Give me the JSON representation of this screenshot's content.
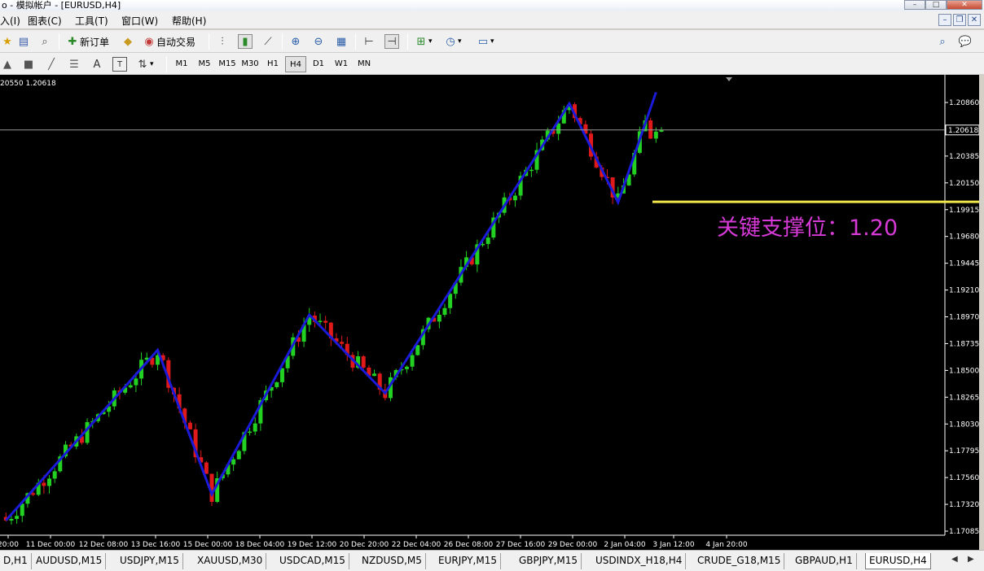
{
  "window": {
    "title": "o - 模拟帐户 - [EURUSD,H4]",
    "min": "–",
    "max": "□",
    "close": "✕"
  },
  "menu": [
    "入(I)",
    "图表(C)",
    "工具(T)",
    "窗口(W)",
    "帮助(H)"
  ],
  "toolbar": {
    "new_order": "新订单",
    "auto_trade": "自动交易"
  },
  "timeframes": [
    "M1",
    "M5",
    "M15",
    "M30",
    "H1",
    "H4",
    "D1",
    "W1",
    "MN"
  ],
  "active_timeframe": "H4",
  "chart": {
    "info_text": "20550 1.20618",
    "annotation": "关键支撑位：1.20",
    "price_labels": [
      "1.20860",
      "1.20618",
      "1.20385",
      "1.20150",
      "1.19915",
      "1.19680",
      "1.19445",
      "1.19210",
      "1.18970",
      "1.18735",
      "1.18500",
      "1.18265",
      "1.18030",
      "1.17795",
      "1.17560",
      "1.17320",
      "1.17085"
    ],
    "current_price": "1.20618",
    "time_labels": [
      "20:00",
      "11 Dec 00:00",
      "12 Dec 08:00",
      "13 Dec 16:00",
      "15 Dec 00:00",
      "18 Dec 04:00",
      "19 Dec 12:00",
      "20 Dec 20:00",
      "22 Dec 04:00",
      "26 Dec 08:00",
      "27 Dec 16:00",
      "29 Dec 00:00",
      "2 Jan 04:00",
      "3 Jan 12:00",
      "4 Jan 20:00"
    ],
    "colors": {
      "background": "#000000",
      "bull": "#22d122",
      "bear": "#e01a1a",
      "zigzag": "#1a1ad8",
      "support": "#f0e64a",
      "annotation": "#d63ad6",
      "axis_text": "#ffffff"
    }
  },
  "chart_data": {
    "type": "candlestick",
    "symbol": "EURUSD",
    "timeframe": "H4",
    "ylim": [
      1.17085,
      1.2086
    ],
    "support_level": 1.19985,
    "zigzag": [
      {
        "bar": 0,
        "price": 1.1718
      },
      {
        "bar": 28,
        "price": 1.1868
      },
      {
        "bar": 38,
        "price": 1.1741
      },
      {
        "bar": 56,
        "price": 1.1899
      },
      {
        "bar": 70,
        "price": 1.183
      },
      {
        "bar": 104,
        "price": 1.2085
      },
      {
        "bar": 113,
        "price": 1.1998
      },
      {
        "bar": 120,
        "price": 1.2095
      }
    ],
    "final_close": 1.20618
  },
  "tabs": [
    "D,H1",
    "AUDUSD,M15",
    "USDJPY,M15",
    "XAUUSD,M30",
    "USDCAD,M15",
    "NZDUSD,M5",
    "EURJPY,M15",
    "GBPJPY,M15",
    "USDINDX_H18,H4",
    "CRUDE_G18,M15",
    "GBPAUD,H1",
    "EURUSD,H4"
  ],
  "active_tab": "EURUSD,H4"
}
